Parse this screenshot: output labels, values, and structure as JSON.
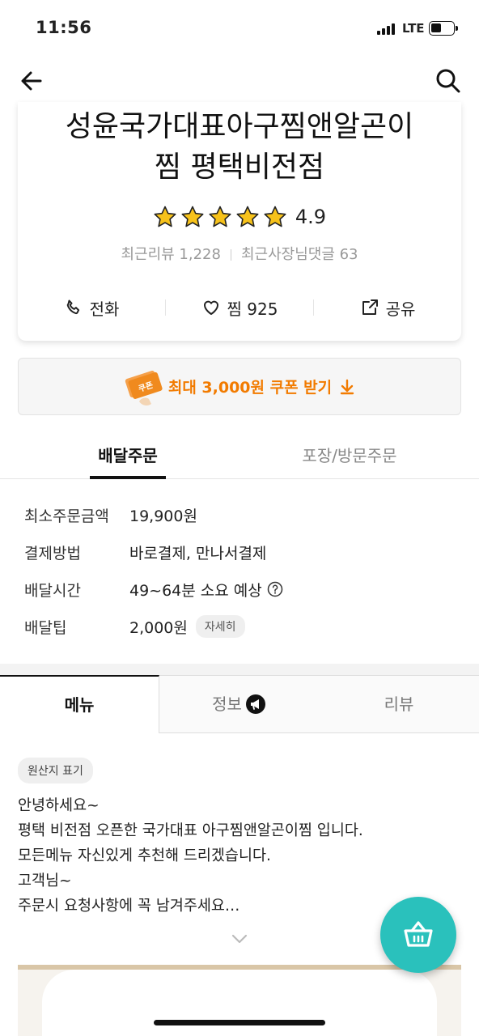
{
  "status": {
    "time": "11:56",
    "network": "LTE"
  },
  "store": {
    "name": "성윤국가대표아구찜앤알곤이 찜 평택비전점",
    "rating": "4.9",
    "star_count": 5,
    "recent_reviews": "최근리뷰 1,228",
    "recent_owner_replies": "최근사장님댓글 63",
    "actions": {
      "call": "전화",
      "like": "찜 925",
      "share": "공유"
    }
  },
  "coupon": {
    "icon_label": "쿠폰",
    "text": "최대 3,000원 쿠폰 받기"
  },
  "order_tabs": {
    "delivery": "배달주문",
    "pickup": "포장/방문주문"
  },
  "delivery_info": [
    {
      "label": "최소주문금액",
      "value": "19,900원"
    },
    {
      "label": "결제방법",
      "value": "바로결제, 만나서결제"
    },
    {
      "label": "배달시간",
      "value": "49~64분 소요 예상"
    },
    {
      "label": "배달팁",
      "value": "2,000원"
    }
  ],
  "tip_detail_button": "자세히",
  "menu_tabs": {
    "menu": "메뉴",
    "info": "정보",
    "reviews": "리뷰"
  },
  "origin_label": "원산지 표기",
  "notice_lines": [
    "안녕하세요~",
    "평택 비전점 오픈한 국가대표 아구찜앤알곤이찜 입니다.",
    "모든메뉴 자신있게 추천해 드리겠습니다.",
    "고객님~",
    "주문시 요청사항에 꼭 남겨주세요…"
  ],
  "colors": {
    "accent_orange": "#f27b00",
    "fab_teal": "#2ac1bc",
    "star_yellow": "#f7c21a"
  }
}
